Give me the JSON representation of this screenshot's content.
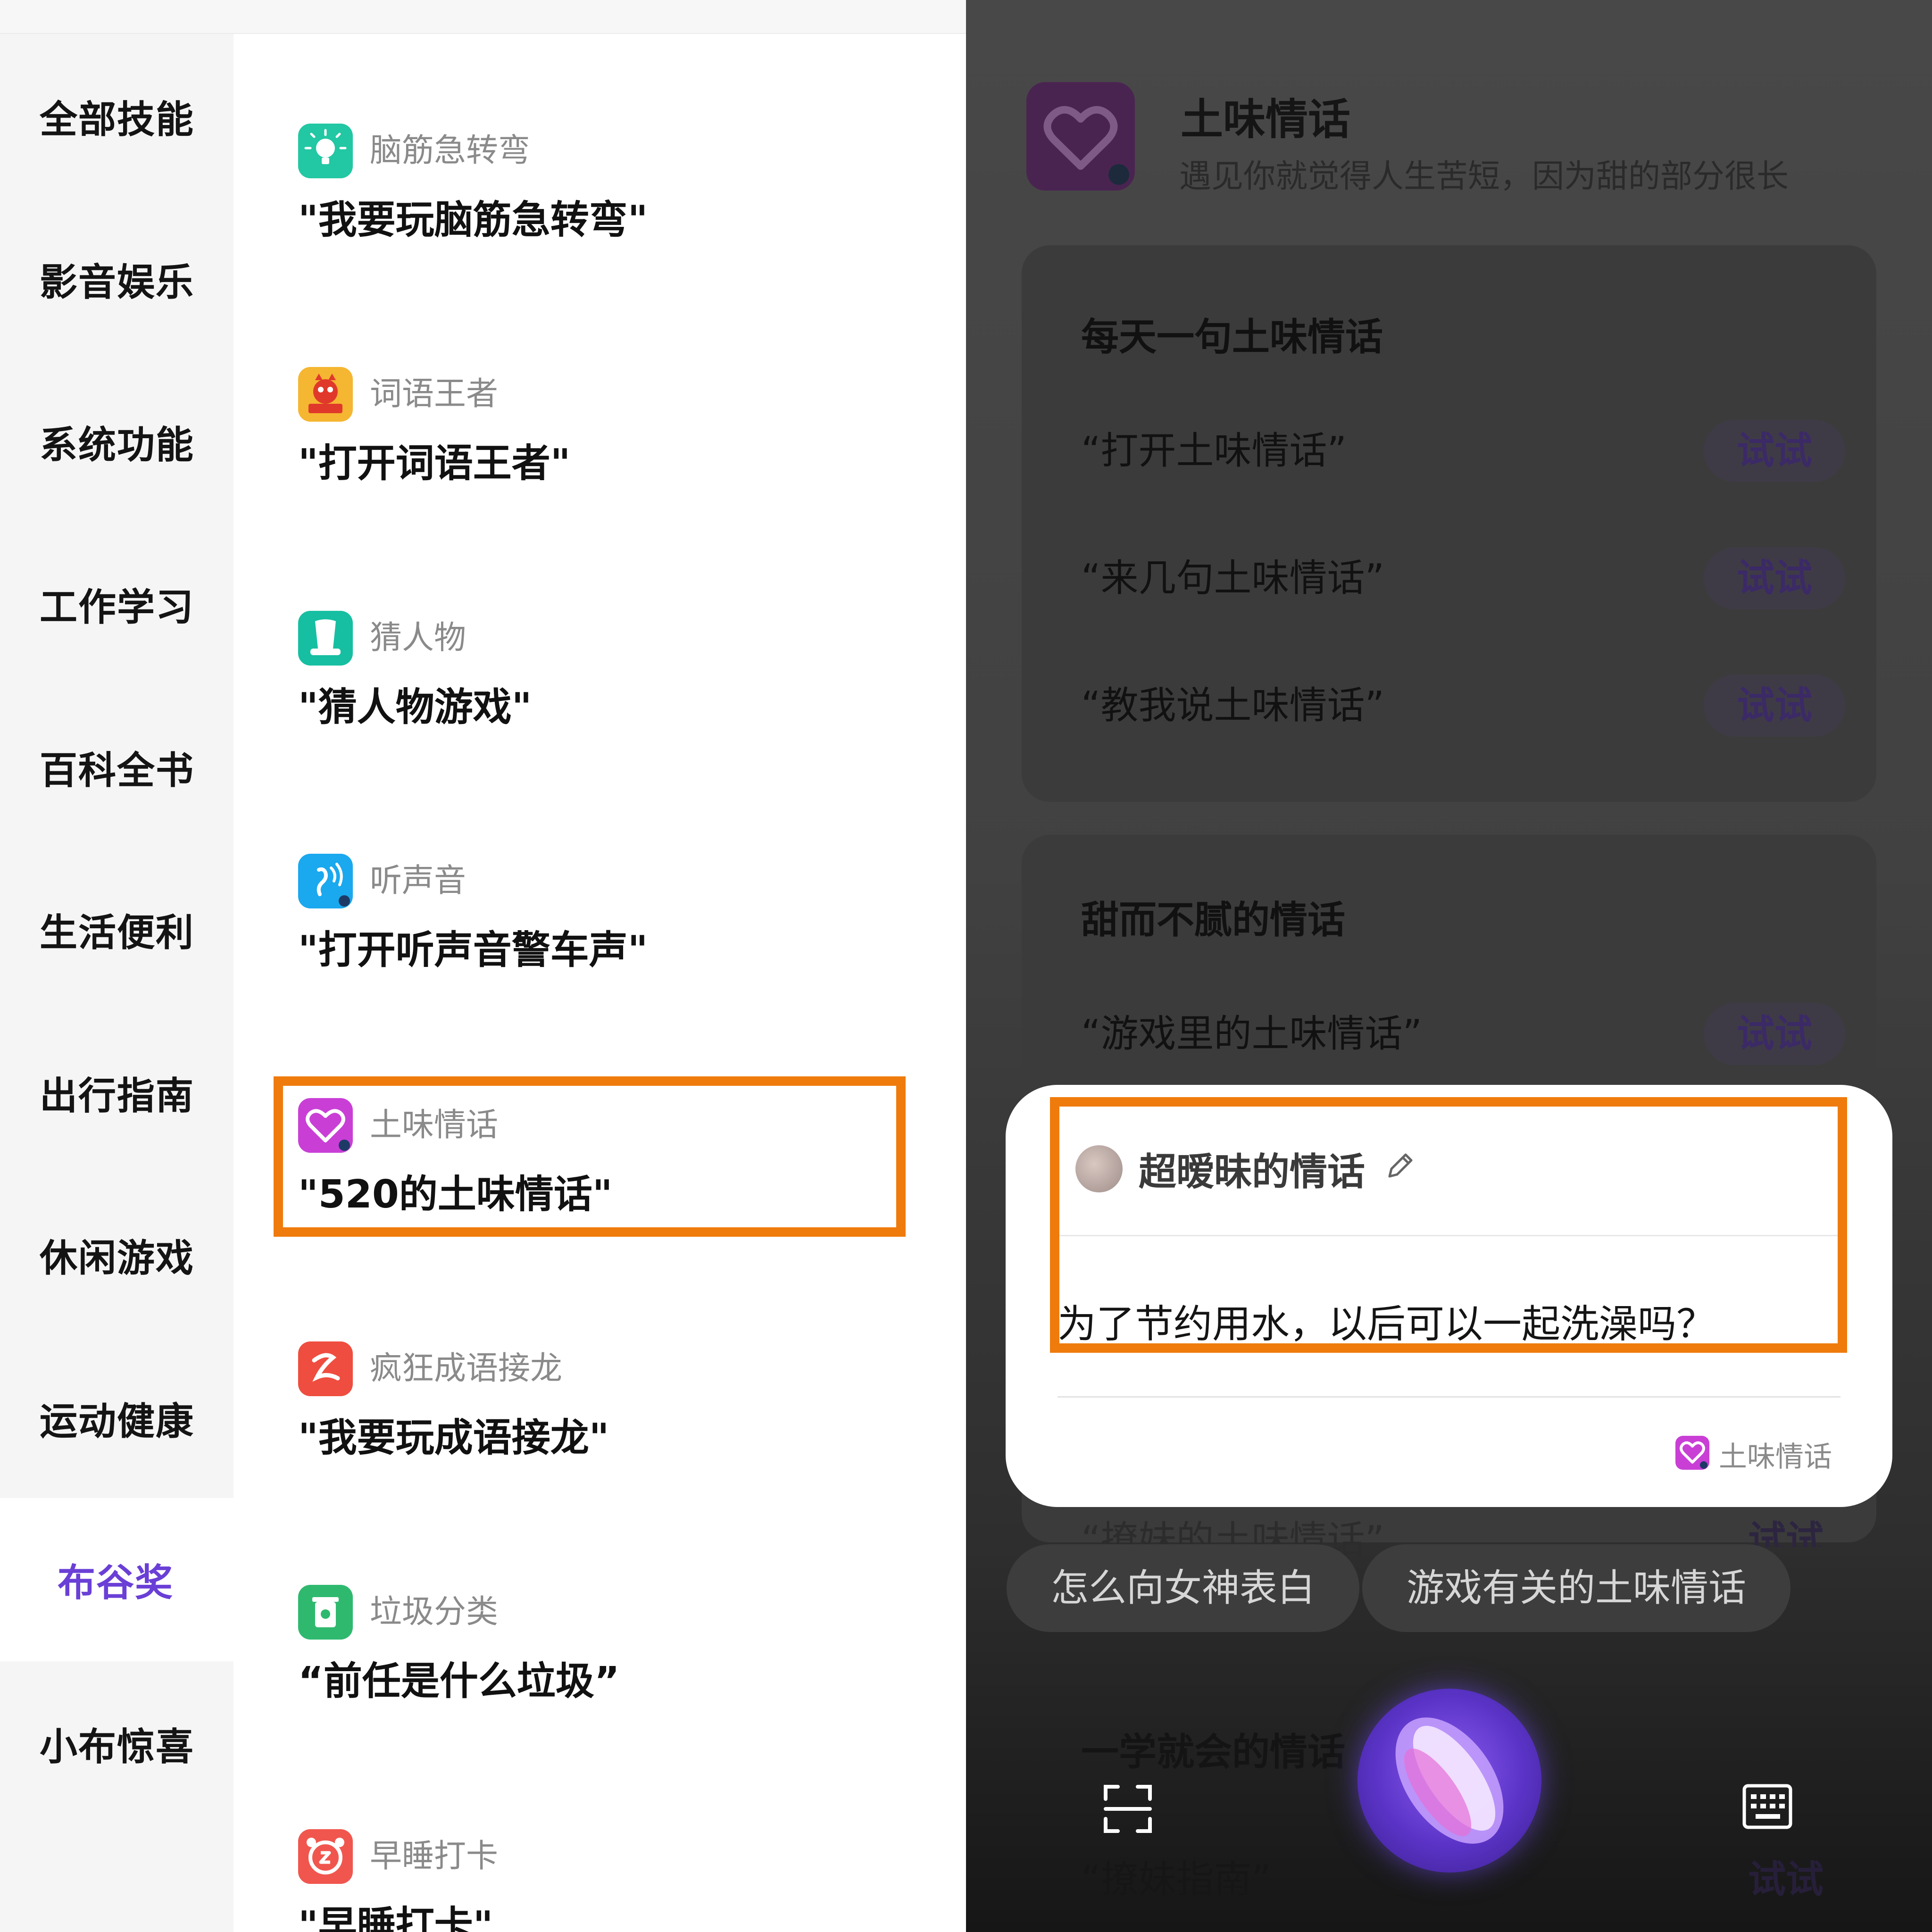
{
  "categories": [
    {
      "label": "全部技能"
    },
    {
      "label": "影音娱乐"
    },
    {
      "label": "系统功能"
    },
    {
      "label": "工作学习"
    },
    {
      "label": "百科全书"
    },
    {
      "label": "生活便利"
    },
    {
      "label": "出行指南"
    },
    {
      "label": "休闲游戏"
    },
    {
      "label": "运动健康"
    },
    {
      "label": "布谷奖",
      "active": true
    },
    {
      "label": "小布惊喜"
    }
  ],
  "skills": [
    {
      "name": "脑筋急转弯",
      "phrase": "\"我要玩脑筋急转弯\"",
      "icon": "lightbulb-icon"
    },
    {
      "name": "词语王者",
      "phrase": "\"打开词语王者\"",
      "icon": "word-king-icon"
    },
    {
      "name": "猜人物",
      "phrase": "\"猜人物游戏\"",
      "icon": "top-hat-icon"
    },
    {
      "name": "听声音",
      "phrase": "\"打开听声音警车声\"",
      "icon": "ear-sound-icon"
    },
    {
      "name": "土味情话",
      "phrase": "\"520的土味情话\"",
      "icon": "heart-icon"
    },
    {
      "name": "疯狂成语接龙",
      "phrase": "\"我要玩成语接龙\"",
      "icon": "dragon-icon"
    },
    {
      "name": "垃圾分类",
      "phrase": "“前任是什么垃圾”",
      "icon": "trash-can-icon"
    },
    {
      "name": "早睡打卡",
      "phrase": "\"早睡打卡\"",
      "icon": "alarm-clock-icon"
    }
  ],
  "detail": {
    "app_title": "土味情话",
    "app_desc": "遇见你就觉得人生苦短，因为甜的部分很长",
    "sections": [
      {
        "title": "每天一句土味情话",
        "examples": [
          {
            "text": "“打开土味情话”",
            "button": "试试"
          },
          {
            "text": "“来几句土味情话”",
            "button": "试试"
          },
          {
            "text": "“教我说土味情话”",
            "button": "试试"
          }
        ]
      },
      {
        "title": "甜而不腻的情话",
        "examples": [
          {
            "text": "“游戏里的土味情话”",
            "button": "试试"
          }
        ]
      }
    ],
    "peek_text": "“撩妹的土味情话”",
    "peek_button": "试试",
    "dim_section_title": "一学就会的情话",
    "dim_example": "“撩妹指南”",
    "dim_button": "试试"
  },
  "popup": {
    "title": "超暧昧的情话",
    "text": "为了节约用水，以后可以一起洗澡吗？",
    "source": "土味情话"
  },
  "suggestions": [
    "怎么向女神表白",
    "游戏有关的土味情话"
  ],
  "colors": {
    "accent": "#6a3fd6",
    "highlight": "#ef7b0c"
  }
}
